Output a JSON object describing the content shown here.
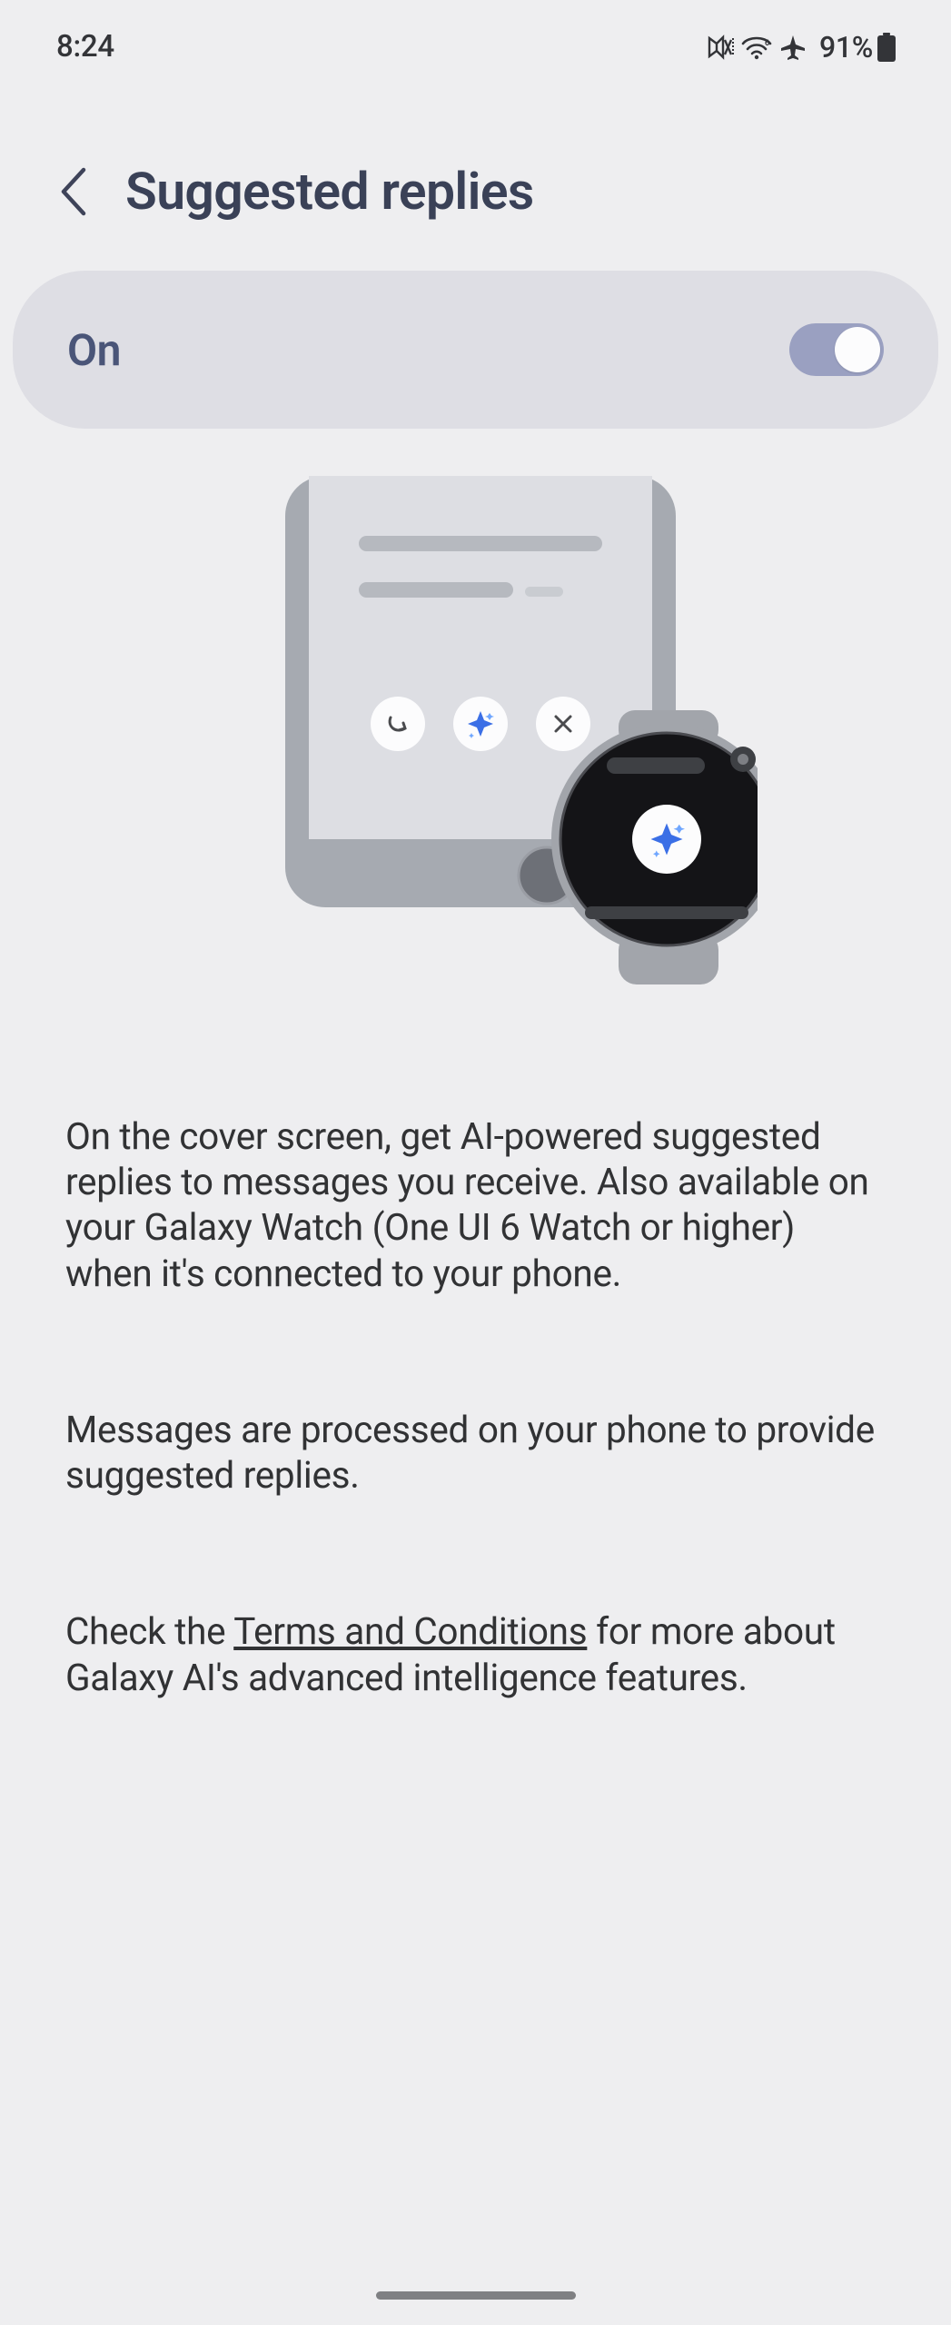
{
  "status": {
    "time": "8:24",
    "battery_pct": "91%"
  },
  "header": {
    "title": "Suggested replies"
  },
  "toggle": {
    "label": "On"
  },
  "body": {
    "p1": "On the cover screen, get AI-powered suggested replies to messages you receive. Also available on your Galaxy Watch (One UI 6 Watch or higher) when it's connected to your phone.",
    "p2": "Messages are processed on your phone to provide suggested replies.",
    "p3_pre": "Check the ",
    "p3_link": "Terms and Conditions",
    "p3_post": " for more about Galaxy AI's advanced intelligence features."
  }
}
